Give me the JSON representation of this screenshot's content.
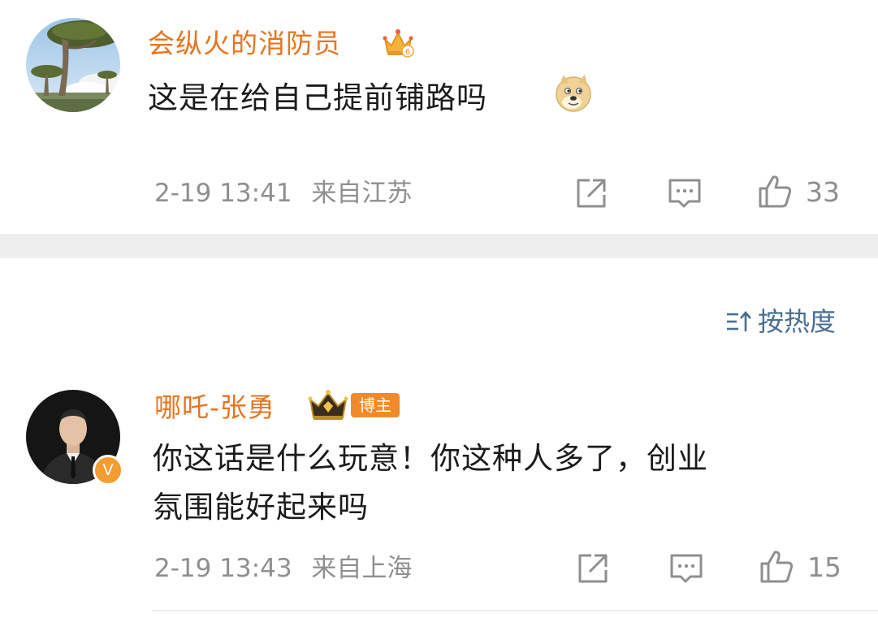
{
  "comments": [
    {
      "username": "会纵火的消防员",
      "text_lines": [
        "这是在给自己提前铺路吗"
      ],
      "emoji": "doge-emoji",
      "time": "2-19 13:41",
      "location": "来自江苏",
      "likes": "33",
      "badge_icon": "crown-vip-icon",
      "badge_level": "6"
    },
    {
      "username": "哪吒-张勇",
      "text_lines": [
        "你这话是什么玩意！你这种人多了，创业",
        "氛围能好起来吗"
      ],
      "time": "2-19 13:43",
      "location": "来自上海",
      "likes": "15",
      "badge_icon": "crown-level-icon",
      "blogger_tag": "博主",
      "verified_mark": "V"
    }
  ],
  "sort": {
    "label": "按热度",
    "icon": "sort-icon"
  },
  "colors": {
    "username": "#e8741f",
    "meta": "#8f8f8f",
    "sort": "#4a6d92",
    "divider": "#eeeeee"
  }
}
